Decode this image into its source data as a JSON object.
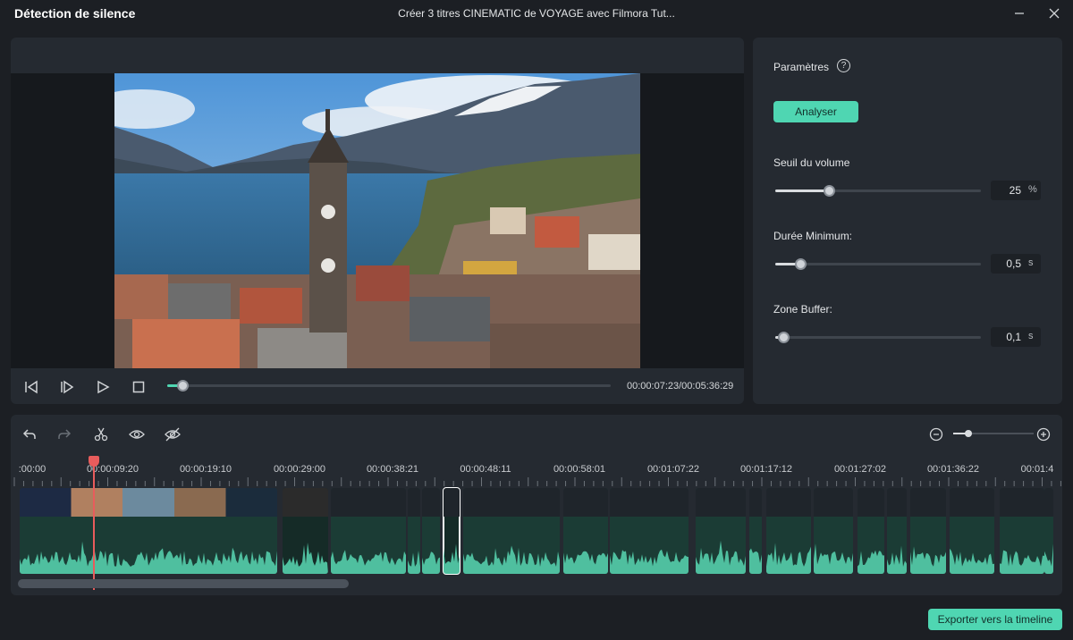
{
  "window": {
    "app_title": "Détection de silence",
    "doc_title": "Créer 3 titres CINEMATIC de VOYAGE avec Filmora  Tut..."
  },
  "player": {
    "timecode": "00:00:07:23/00:05:36:29",
    "progress": 0.035
  },
  "settings": {
    "title": "Paramètres",
    "help_glyph": "?",
    "analyze_label": "Analyser",
    "volume": {
      "label": "Seuil du volume",
      "value": "25",
      "unit": "%",
      "level": 0.26
    },
    "min_duration": {
      "label": "Durée Minimum:",
      "value": "0,5",
      "unit": "s",
      "level": 0.12
    },
    "buffer": {
      "label": "Zone Buffer:",
      "value": "0,1",
      "unit": "s",
      "level": 0.04
    }
  },
  "timeline": {
    "ruler_labels": [
      ":00:00",
      "00:00:09:20",
      "00:00:19:10",
      "00:00:29:00",
      "00:00:38:21",
      "00:00:48:11",
      "00:00:58:01",
      "00:01:07:22",
      "00:01:17:12",
      "00:01:27:02",
      "00:01:36:22",
      "00:01:4"
    ]
  },
  "export_label": "Exporter vers la timeline",
  "colors": {
    "accent": "#4fd6b2",
    "playhead": "#e85c5c",
    "panel": "#252a31",
    "background": "#1c1f24"
  }
}
